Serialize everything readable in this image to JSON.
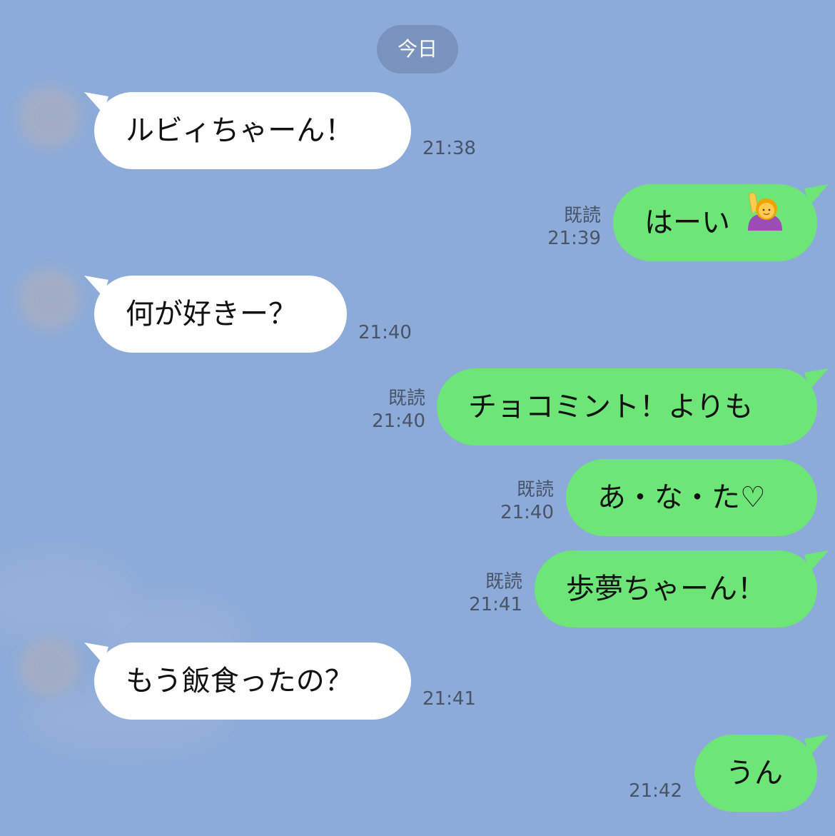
{
  "date_divider": "今日",
  "messages": [
    {
      "side": "in",
      "text": "ルビィちゃーん！",
      "time": "21:38"
    },
    {
      "side": "out",
      "text": "はーい",
      "emoji": "person-raising-hand-emoji",
      "read": "既読",
      "time": "21:39"
    },
    {
      "side": "in",
      "text": "何が好きー？",
      "time": "21:40"
    },
    {
      "side": "out",
      "text": "チョコミント！よりも",
      "read": "既読",
      "time": "21:40"
    },
    {
      "side": "out",
      "text": "あ・な・た♡",
      "read": "既読",
      "time": "21:40"
    },
    {
      "side": "out",
      "text": "歩夢ちゃーん！",
      "read": "既読",
      "time": "21:41"
    },
    {
      "side": "in",
      "text": "もう飯食ったの？",
      "time": "21:41"
    },
    {
      "side": "out",
      "text": "うん",
      "time": "21:42"
    }
  ],
  "colors": {
    "background": "#8dabd8",
    "incoming_bubble": "#ffffff",
    "outgoing_bubble": "#6de577",
    "date_pill": "#7a93bc",
    "meta_text": "#4a5468"
  }
}
